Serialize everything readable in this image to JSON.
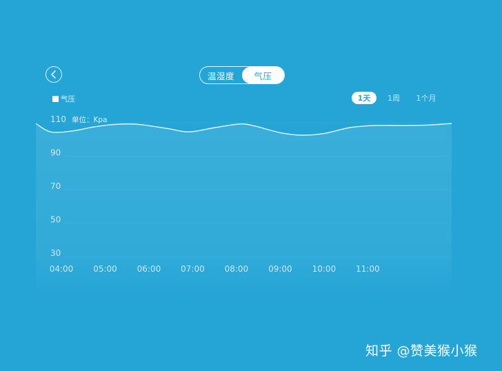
{
  "header": {
    "tabs": [
      {
        "label": "温湿度",
        "active": false
      },
      {
        "label": "气压",
        "active": true
      }
    ]
  },
  "legend": {
    "label": "气压"
  },
  "range_tabs": [
    {
      "label": "1天",
      "active": true
    },
    {
      "label": "1周",
      "active": false
    },
    {
      "label": "1个月",
      "active": false
    }
  ],
  "unit_label": "单位：Kpa",
  "watermark": "知乎 @赞美猴小猴",
  "colors": {
    "background": "#24a5d6",
    "line": "#ffffff",
    "accent_text": "#24a5d6"
  },
  "chart_data": {
    "type": "area",
    "y_ticks": [
      110,
      90,
      70,
      50,
      30
    ],
    "ylim": [
      30,
      110
    ],
    "x_ticks": [
      "04:00",
      "05:00",
      "06:00",
      "07:00",
      "08:00",
      "09:00",
      "10:00",
      "11:00"
    ],
    "xlim": [
      "03:25",
      "12:55"
    ],
    "series": [
      {
        "x": [
          "03:25",
          "03:45",
          "04:15",
          "04:45",
          "05:15",
          "05:45",
          "06:25",
          "06:55",
          "07:30",
          "08:05",
          "08:25",
          "09:00",
          "09:30",
          "10:00",
          "10:35",
          "11:10",
          "11:45",
          "12:20",
          "12:55"
        ],
        "values": [
          107.5,
          102.5,
          103,
          105.5,
          107,
          107,
          104.5,
          102.5,
          105,
          107.2,
          106,
          102,
          100.5,
          101.5,
          105,
          106.3,
          106.3,
          106.5,
          107.5
        ]
      }
    ],
    "grid": true,
    "legend_position": "top-left"
  }
}
